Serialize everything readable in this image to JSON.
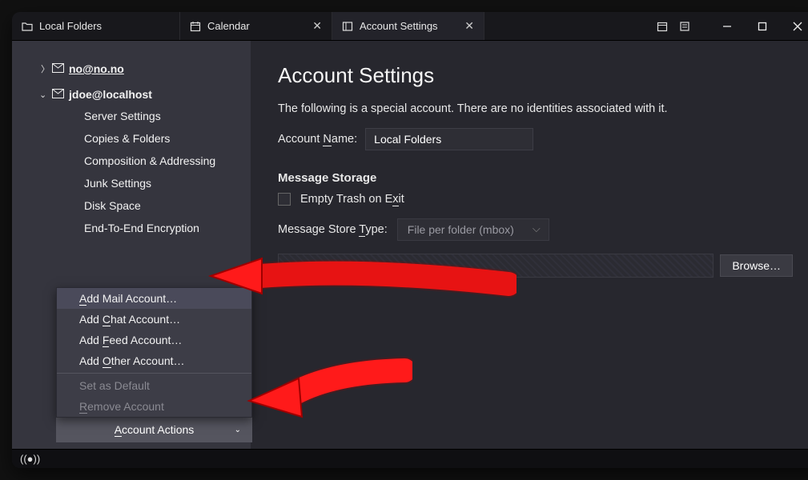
{
  "tabs": {
    "local": "Local Folders",
    "calendar": "Calendar",
    "settings": "Account Settings"
  },
  "sidebar": {
    "acct1": "no@no.no",
    "acct2": "jdoe@localhost",
    "sub": {
      "server": "Server Settings",
      "copies": "Copies & Folders",
      "comp": "Composition & Addressing",
      "junk": "Junk Settings",
      "disk": "Disk Space",
      "e2e": "End-To-End Encryption"
    },
    "actions_label": "Account Actions"
  },
  "ctx": {
    "add_mail": "Add Mail Account…",
    "add_chat": "Add Chat Account…",
    "add_feed": "Add Feed Account…",
    "add_other": "Add Other Account…",
    "set_default": "Set as Default",
    "remove": "Remove Account"
  },
  "content": {
    "title": "Account Settings",
    "desc": "The following is a special account. There are no identities associated with it.",
    "name_label": "Account Name:",
    "name_value": "Local Folders",
    "storage_heading": "Message Storage",
    "empty_trash": "Empty Trash on Exit",
    "store_type_label": "Message Store Type:",
    "store_type_value": "File per folder (mbox)",
    "browse": "Browse…"
  }
}
